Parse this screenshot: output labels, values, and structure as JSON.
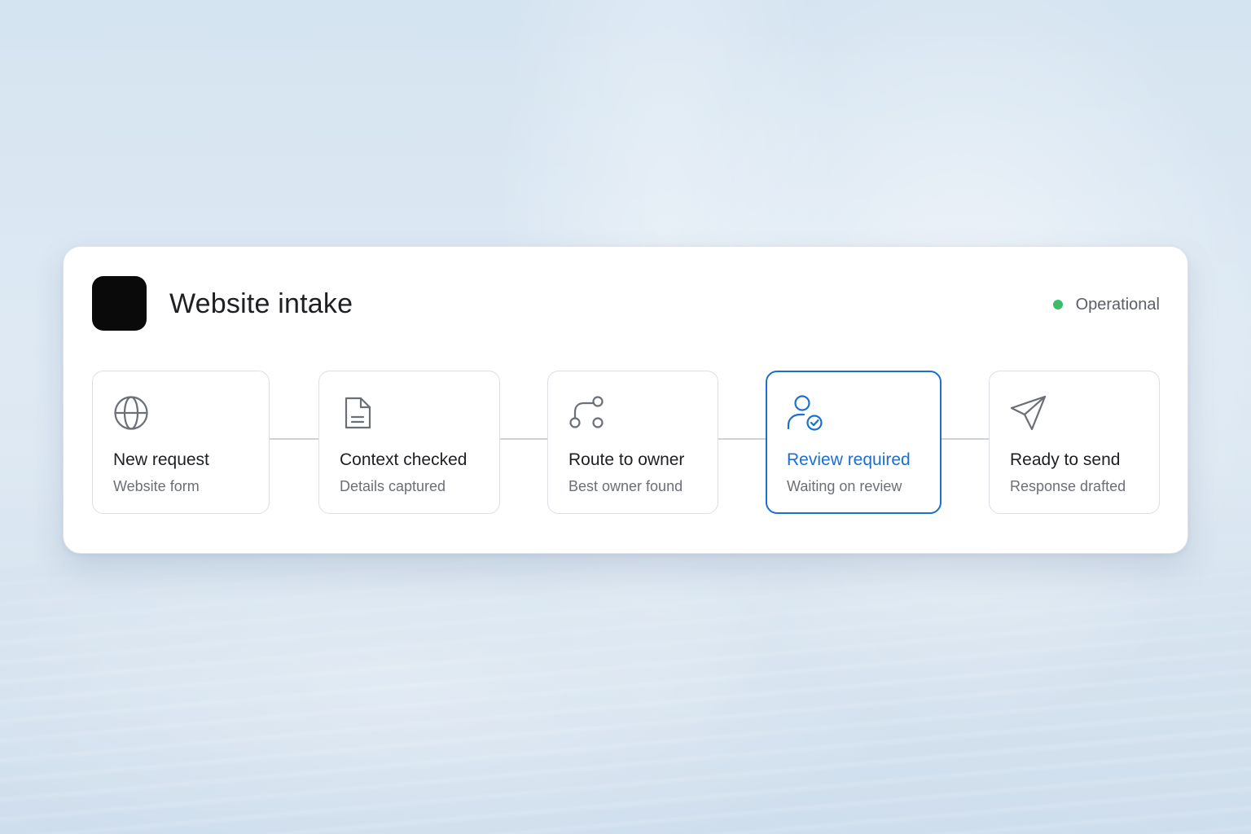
{
  "workflow": {
    "title": "Website intake",
    "status": {
      "label": "Operational",
      "color": "#3dbb6b"
    },
    "accent_color": "#1a6fd1",
    "steps": [
      {
        "title": "New request",
        "subtitle": "Website form",
        "icon": "globe-icon",
        "state": "done"
      },
      {
        "title": "Context checked",
        "subtitle": "Details captured",
        "icon": "document-icon",
        "state": "done"
      },
      {
        "title": "Route to owner",
        "subtitle": "Best owner found",
        "icon": "route-icon",
        "state": "done"
      },
      {
        "title": "Review required",
        "subtitle": "Waiting on review",
        "icon": "user-check-icon",
        "state": "active"
      },
      {
        "title": "Ready to send",
        "subtitle": "Response drafted",
        "icon": "send-icon",
        "state": "pending"
      }
    ]
  }
}
